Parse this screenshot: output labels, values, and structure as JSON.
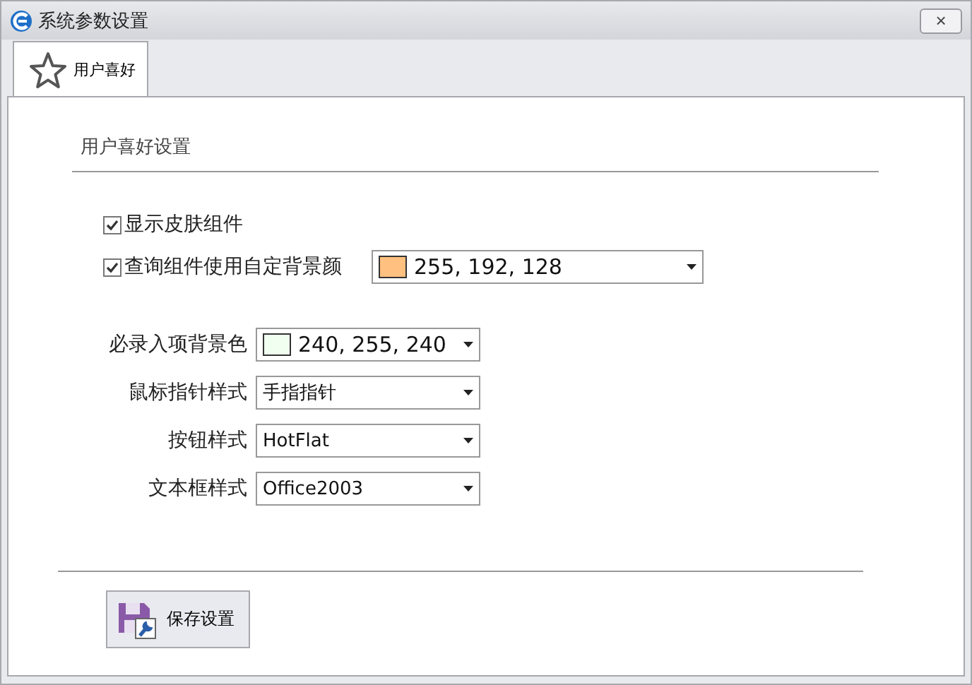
{
  "window": {
    "title": "系统参数设置",
    "close": "×"
  },
  "tabs": [
    {
      "label": "用户喜好",
      "selected": true
    }
  ],
  "group": {
    "title": "用户喜好设置"
  },
  "checkboxes": [
    {
      "label": "显示皮肤组件",
      "checked": true
    },
    {
      "label": "查询组件使用自定背景颜",
      "checked": true,
      "combo": {
        "kind": "color",
        "value": "255, 192, 128",
        "color": "#ffc080"
      }
    }
  ],
  "fields": [
    {
      "label": "必录入项背景色",
      "kind": "color",
      "value": "240, 255, 240",
      "color": "#f0fff0"
    },
    {
      "label": "鼠标指针样式",
      "kind": "text",
      "value": "手指指针"
    },
    {
      "label": "按钮样式",
      "kind": "text",
      "value": "HotFlat"
    },
    {
      "label": "文本框样式",
      "kind": "text",
      "value": "Office2003"
    }
  ],
  "buttons": [
    {
      "label": "保存设置"
    }
  ]
}
